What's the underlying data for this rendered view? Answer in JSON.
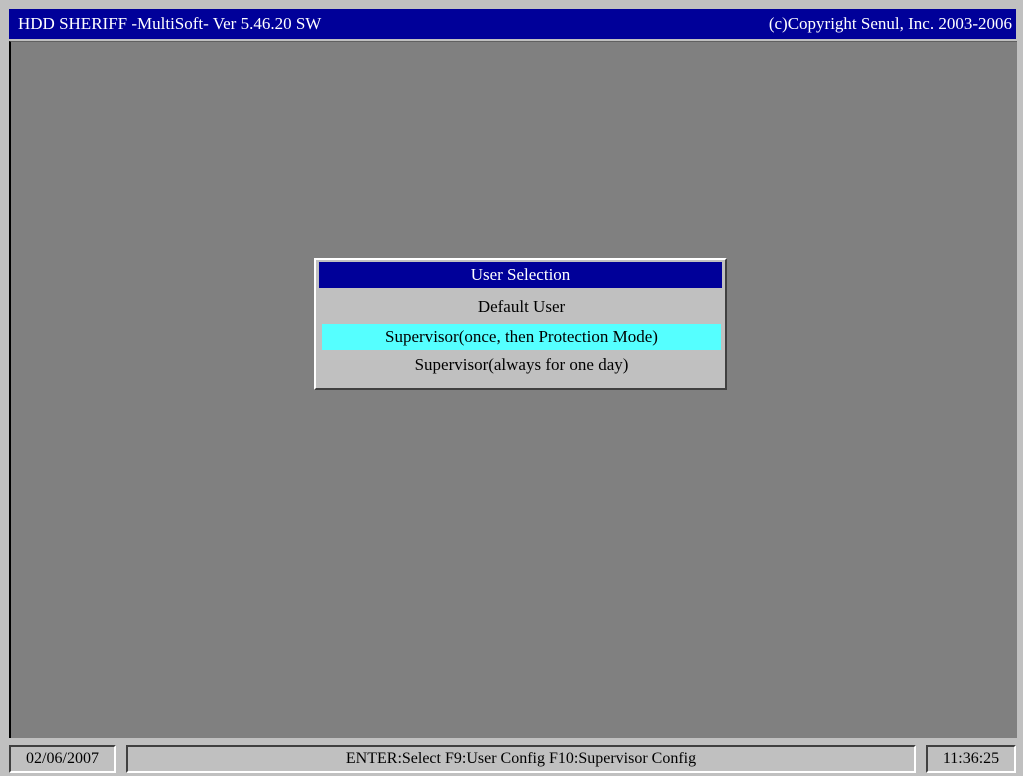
{
  "titlebar": {
    "title": "HDD SHERIFF -MultiSoft- Ver 5.46.20 SW",
    "copyright": "(c)Copyright  Senul, Inc. 2003-2006"
  },
  "dialog": {
    "title": "User Selection",
    "options": [
      {
        "label": "Default User",
        "selected": false
      },
      {
        "label": "Supervisor(once, then Protection Mode)",
        "selected": true
      },
      {
        "label": "Supervisor(always for one day)",
        "selected": false
      }
    ]
  },
  "statusbar": {
    "date": "02/06/2007",
    "keys": "ENTER:Select  F9:User Config  F10:Supervisor Config",
    "time": "11:36:25"
  },
  "colors": {
    "title_bar": "#000099",
    "desktop": "#808080",
    "panel": "#c0c0c0",
    "selection": "#55ffff"
  }
}
